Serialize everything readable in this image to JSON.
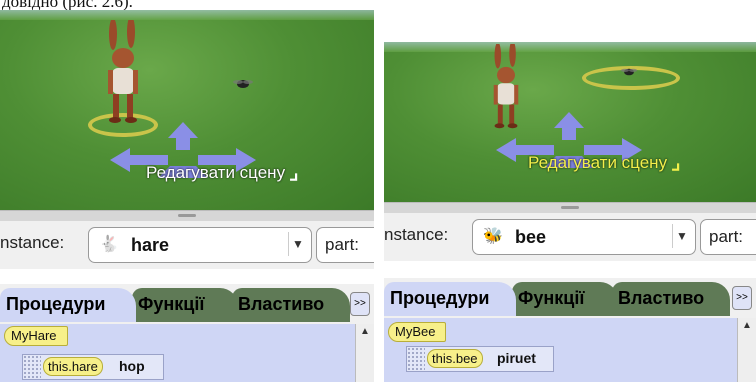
{
  "caption": "довідно (рис. 2.6).",
  "left": {
    "scene": {
      "edit_scene_label": "Редагувати сцену"
    },
    "instance": {
      "label": "nstance:",
      "value": "hare",
      "part_label": "part:"
    },
    "tabs": [
      {
        "label": "Процедури",
        "active": true
      },
      {
        "label": "Функції",
        "active": false
      },
      {
        "label": "Властиво",
        "active": false
      }
    ],
    "more_button": ">>",
    "owner_tag": "MyHare",
    "method": {
      "object": "this.hare",
      "name": "hop"
    }
  },
  "right": {
    "scene": {
      "edit_scene_label": "Редагувати сцену"
    },
    "instance": {
      "label": "nstance:",
      "value": "bee",
      "part_label": "part:"
    },
    "tabs": [
      {
        "label": "Процедури",
        "active": true
      },
      {
        "label": "Функції",
        "active": false
      },
      {
        "label": "Властиво",
        "active": false
      }
    ],
    "more_button": ">>",
    "owner_tag": "MyBee",
    "method": {
      "object": "this.bee",
      "name": "piruet"
    }
  },
  "icons": {
    "edit_scene": "edit-scene-corner-icon",
    "hare": "hare-icon",
    "bee": "bee-icon",
    "dropdown": "chevron-down-icon",
    "scroll_up": "scroll-up-arrow-icon",
    "move_arrows": "move-arrows-icon"
  },
  "colors": {
    "grass": "#4f8f35",
    "ring": "#c9c44a",
    "edit_scene_right": "#f2ef4a",
    "tab_active": "#cfd6f5",
    "tab_inactive": "#5f7a56",
    "tag": "#f7f08a"
  }
}
